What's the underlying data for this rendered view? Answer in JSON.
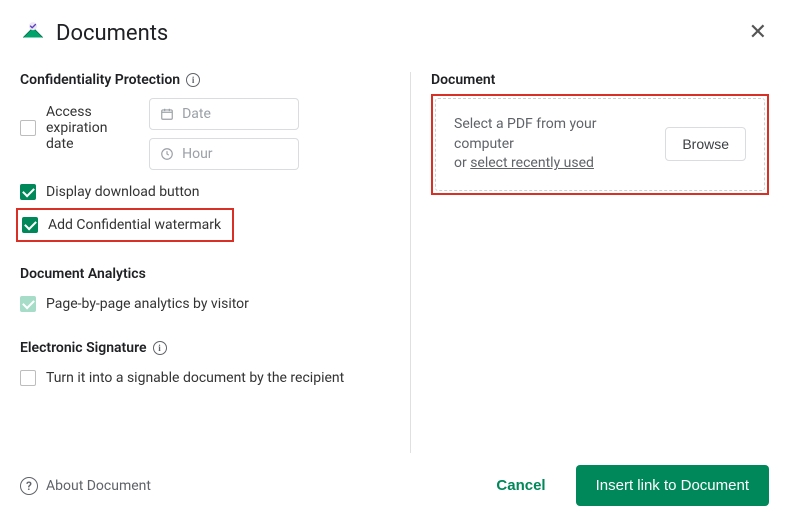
{
  "header": {
    "title": "Documents"
  },
  "confidentiality": {
    "title": "Confidentiality Protection",
    "access_expiration": {
      "label": "Access expiration date",
      "checked": false
    },
    "date_placeholder": "Date",
    "hour_placeholder": "Hour",
    "display_download": {
      "label": "Display download button",
      "checked": true
    },
    "add_watermark": {
      "label": "Add Confidential watermark",
      "checked": true
    }
  },
  "analytics": {
    "title": "Document Analytics",
    "page_by_page": {
      "label": "Page-by-page analytics by visitor",
      "checked": true,
      "disabled": true
    }
  },
  "signature": {
    "title": "Electronic Signature",
    "signable": {
      "label": "Turn it into a signable document by the recipient",
      "checked": false
    }
  },
  "document": {
    "title": "Document",
    "prompt_line1": "Select a PDF from your computer",
    "prompt_or": "or ",
    "prompt_link": "select recently used",
    "browse": "Browse"
  },
  "footer": {
    "about": "About Document",
    "cancel": "Cancel",
    "primary": "Insert link to Document"
  }
}
